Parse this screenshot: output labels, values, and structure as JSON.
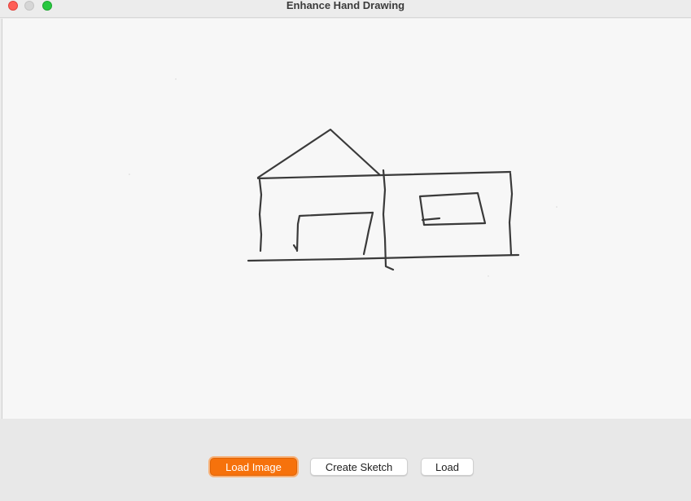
{
  "window": {
    "title": "Enhance Hand Drawing"
  },
  "canvas": {
    "content": "hand-drawn house sketch"
  },
  "toolbar": {
    "load_image_label": "Load Image",
    "create_sketch_label": "Create Sketch",
    "load_label": "Load"
  },
  "colors": {
    "accent": "#f6720c",
    "close": "#ff5f57",
    "minimize": "#d6d6d6",
    "zoom": "#28c840"
  }
}
